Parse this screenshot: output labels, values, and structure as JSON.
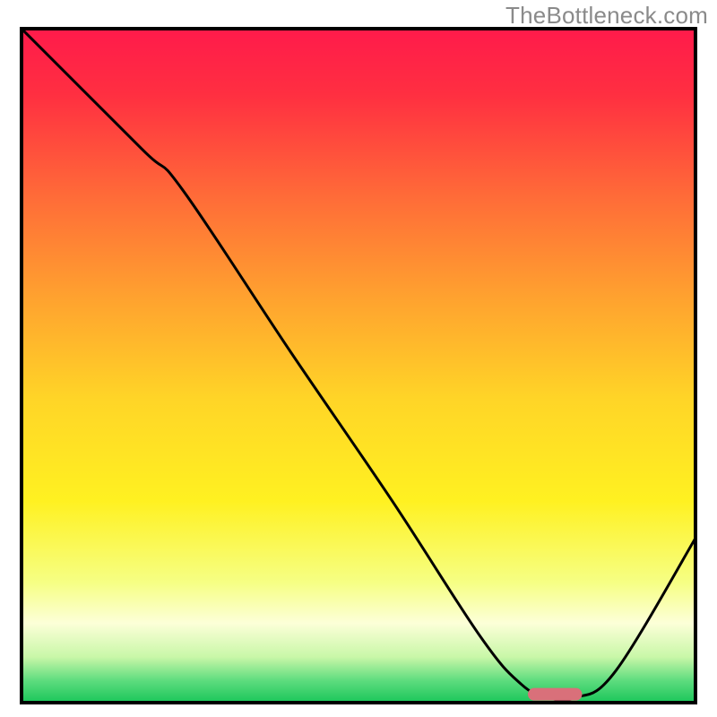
{
  "watermark": "TheBottleneck.com",
  "chart_data": {
    "type": "line",
    "title": "",
    "xlabel": "",
    "ylabel": "",
    "xlim": [
      0,
      100
    ],
    "ylim": [
      0,
      100
    ],
    "grid": false,
    "legend": false,
    "axes_visible": false,
    "background_gradient": {
      "stops": [
        {
          "offset": 0.0,
          "color": "#ff1a4b"
        },
        {
          "offset": 0.1,
          "color": "#ff2f41"
        },
        {
          "offset": 0.25,
          "color": "#ff6b38"
        },
        {
          "offset": 0.4,
          "color": "#ffa22f"
        },
        {
          "offset": 0.55,
          "color": "#ffd527"
        },
        {
          "offset": 0.7,
          "color": "#fff121"
        },
        {
          "offset": 0.82,
          "color": "#f6ff84"
        },
        {
          "offset": 0.88,
          "color": "#fcffd8"
        },
        {
          "offset": 0.93,
          "color": "#c9f7a8"
        },
        {
          "offset": 0.965,
          "color": "#5ddc7e"
        },
        {
          "offset": 1.0,
          "color": "#15c457"
        }
      ]
    },
    "series": [
      {
        "name": "bottleneck-curve",
        "x": [
          0,
          18,
          24,
          40,
          55,
          68,
          74,
          78,
          82,
          88,
          100
        ],
        "y": [
          100,
          82,
          76,
          52,
          30,
          10,
          3,
          1,
          1,
          5,
          25
        ]
      }
    ],
    "marker": {
      "name": "optimal-range",
      "x_start": 75,
      "x_end": 83,
      "y": 1.5,
      "color": "#d9707a"
    },
    "frame_color": "#000000",
    "line_color": "#000000"
  }
}
